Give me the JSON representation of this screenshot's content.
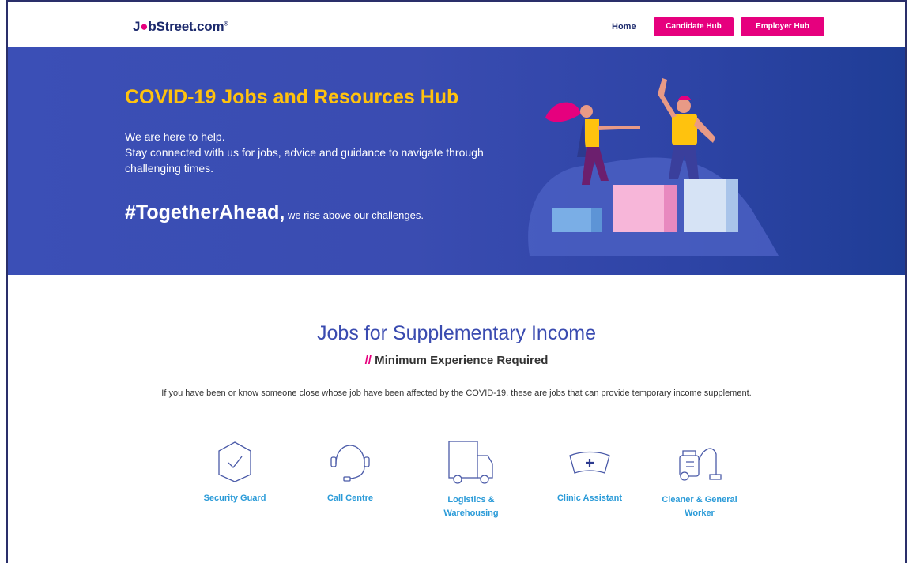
{
  "header": {
    "logo": {
      "part1": "J",
      "part2": "bStreet.com",
      "reg": "®"
    },
    "nav": {
      "home": "Home",
      "candidate_hub": "Candidate Hub",
      "employer_hub": "Employer Hub"
    }
  },
  "hero": {
    "title": "COVID-19 Jobs and Resources Hub",
    "line1": "We are here to help.",
    "line2": "Stay connected with us for jobs, advice and guidance to navigate through challenging times.",
    "hashtag": "#TogetherAhead,",
    "tagline": " we rise above our challenges."
  },
  "section": {
    "title": "Jobs for Supplementary Income",
    "sub_slash": "//",
    "sub_text": " Minimum Experience Required",
    "description": "If you have been or know someone close whose job have been affected by the COVID-19, these are jobs that can provide temporary income supplement."
  },
  "jobs": [
    {
      "label": "Security Guard",
      "icon": "shield-icon"
    },
    {
      "label": "Call Centre",
      "icon": "headset-icon"
    },
    {
      "label": "Logistics & Warehousing",
      "icon": "truck-icon"
    },
    {
      "label": "Clinic Assistant",
      "icon": "nurse-cap-icon"
    },
    {
      "label": "Cleaner & General Worker",
      "icon": "vacuum-icon"
    }
  ],
  "colors": {
    "brand_navy": "#1c2a6d",
    "accent_pink": "#e6007e",
    "hero_blue": "#3b4fb6",
    "hero_yellow": "#ffc20e",
    "job_label_blue": "#2b9bd8"
  }
}
